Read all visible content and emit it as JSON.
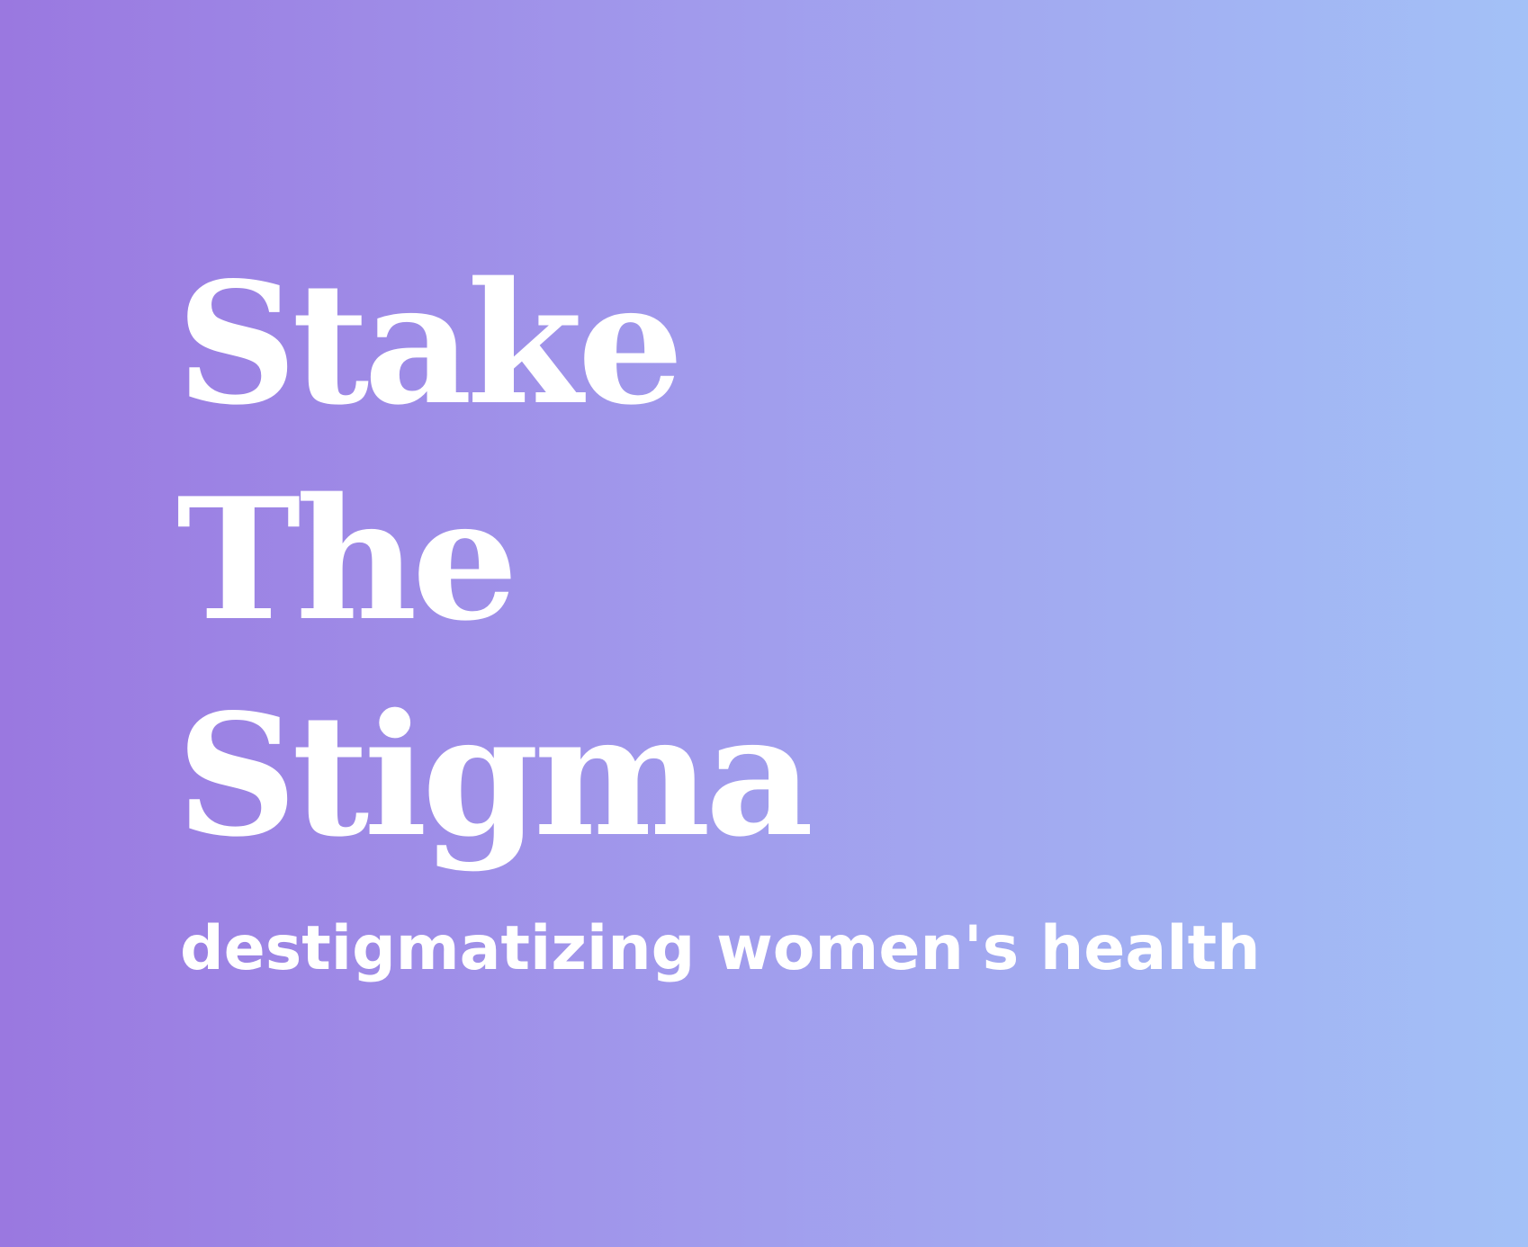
{
  "hero": {
    "title_lines": [
      "Stake",
      "The",
      "Stigma"
    ],
    "subtitle": "destigmatizing women's health",
    "gradient": {
      "start": "#9a78e0",
      "middle": "#a19aec",
      "end": "#a3c1f7"
    },
    "text_color": "#ffffff"
  }
}
